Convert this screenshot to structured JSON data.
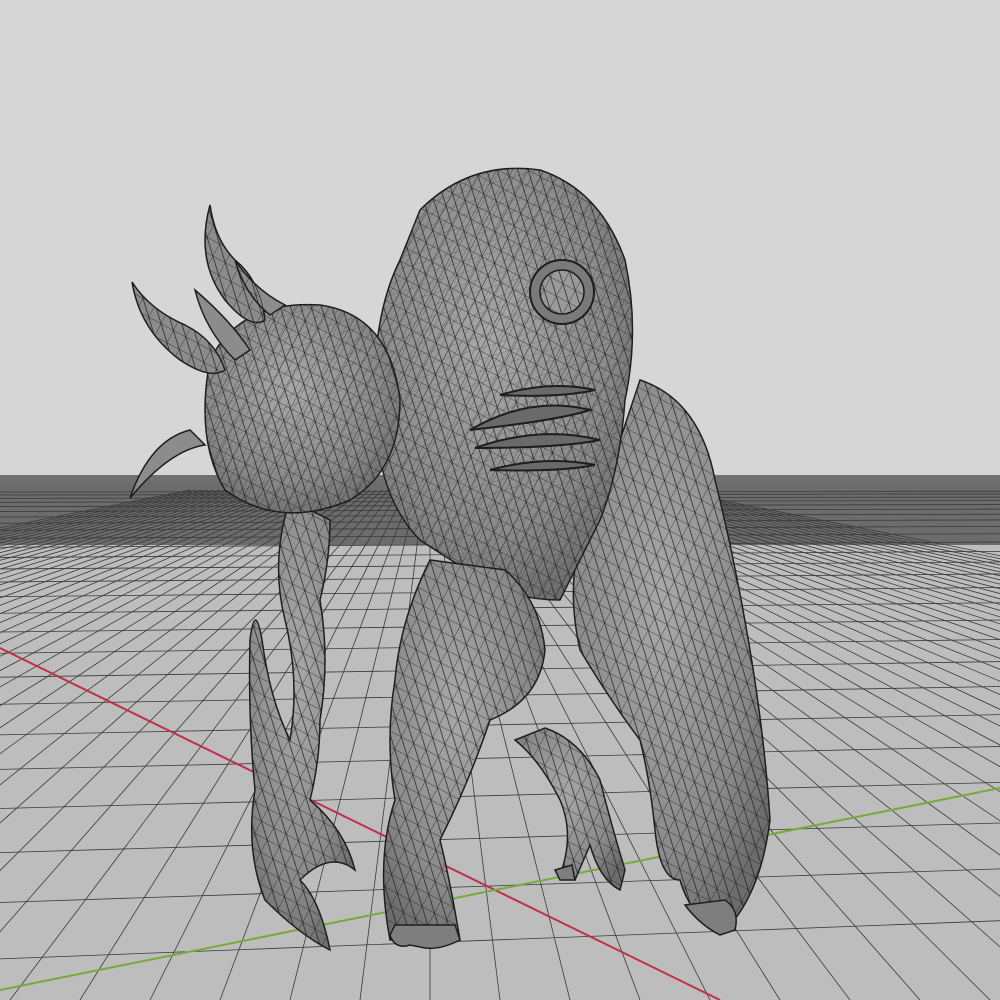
{
  "viewport": {
    "background_color": "#d6d6d6",
    "ground_color": "#bdbdbd",
    "far_ground_color": "#5e5e5e",
    "grid_line_color": "#3a3a3a",
    "x_axis_color": "#c0304a",
    "y_axis_color": "#7aa83a"
  },
  "model": {
    "icon": "wireframe-creature-model",
    "fill_color": "#8f8f8f",
    "wire_color": "#1e1e1e"
  }
}
